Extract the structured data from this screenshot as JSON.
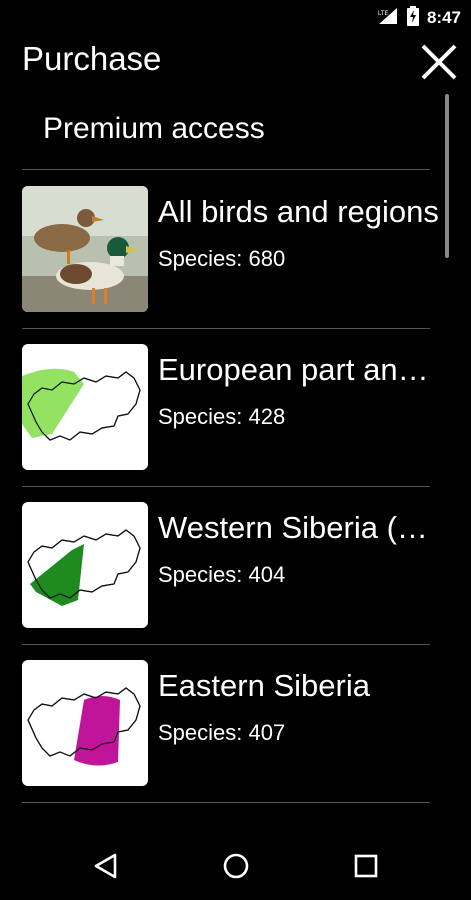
{
  "status_bar": {
    "time": "8:47",
    "network": "LTE"
  },
  "header": {
    "title": "Purchase"
  },
  "section": {
    "title": "Premium access"
  },
  "items": [
    {
      "name": "All birds and regions",
      "species": "Species: 680",
      "thumbnail": "ducks-photo"
    },
    {
      "name": "European part and Urals",
      "species": "Species: 428",
      "thumbnail": "map-europe",
      "region_color": "#8ee05a"
    },
    {
      "name": "Western Siberia (and Kazakhstan)",
      "species": "Species: 404",
      "thumbnail": "map-western-siberia",
      "region_color": "#1f8a1f"
    },
    {
      "name": "Eastern Siberia",
      "species": "Species: 407",
      "thumbnail": "map-eastern-siberia",
      "region_color": "#c0159a"
    }
  ],
  "navigation": {
    "back": "back-icon",
    "home": "home-icon",
    "recents": "recents-icon"
  }
}
